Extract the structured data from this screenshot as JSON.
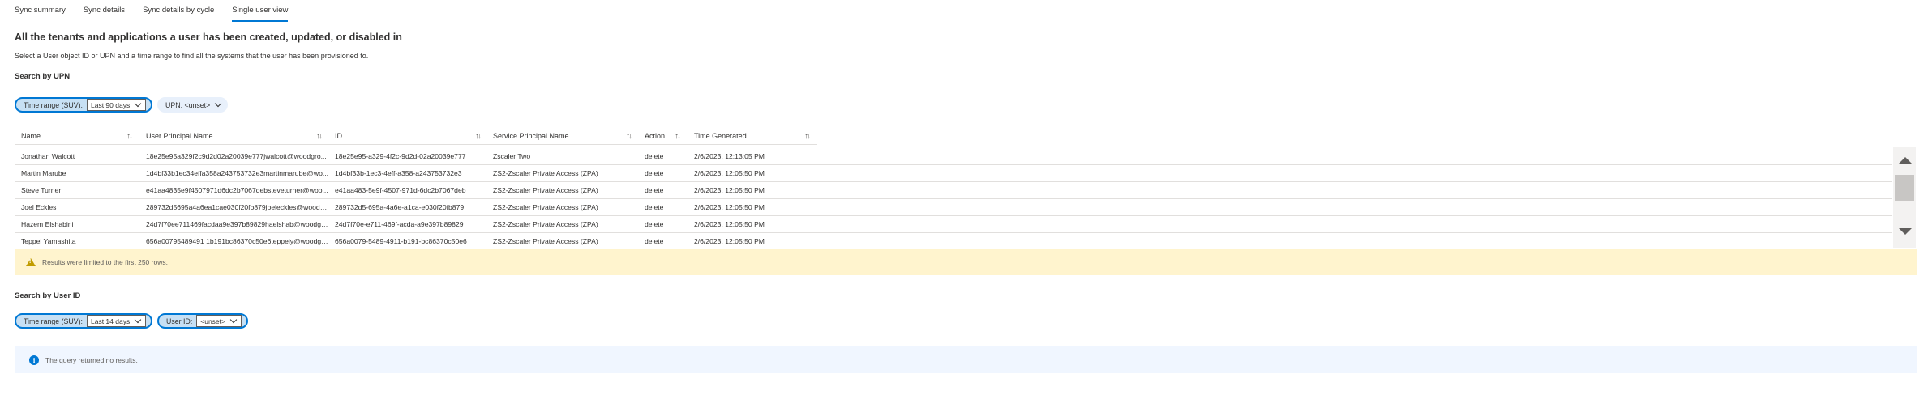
{
  "tabs": [
    {
      "label": "Sync summary"
    },
    {
      "label": "Sync details"
    },
    {
      "label": "Sync details by cycle"
    },
    {
      "label": "Single user view"
    }
  ],
  "active_tab": "Single user view",
  "header": {
    "title": "All the tenants and applications a user has been created, updated, or disabled in",
    "subtitle": "Select a User object ID or UPN and a time range to find all the systems that the user has been provisioned to."
  },
  "upn_section": {
    "label": "Search by UPN",
    "time_range": {
      "label": "Time range (SUV):",
      "value": "Last 90 days"
    },
    "upn_filter": {
      "label": "UPN: <unset>"
    },
    "columns": [
      "Name",
      "User Principal Name",
      "ID",
      "Service Principal Name",
      "Action",
      "Time Generated"
    ],
    "rows": [
      [
        "Jonathan Walcott",
        "18e25e95a329f2c9d2d02a20039e777jwalcott@woodgro...",
        "18e25e95-a329-4f2c-9d2d-02a20039e777",
        "Zscaler Two",
        "delete",
        "2/6/2023, 12:13:05 PM"
      ],
      [
        "Martin Marube",
        "1d4bf33b1ec34effa358a243753732e3martinmarube@wo...",
        "1d4bf33b-1ec3-4eff-a358-a243753732e3",
        "ZS2-Zscaler Private Access (ZPA)",
        "delete",
        "2/6/2023, 12:05:50 PM"
      ],
      [
        "Steve Turner",
        "e41aa4835e9f4507971d6dc2b7067debsteveturner@woo...",
        "e41aa483-5e9f-4507-971d-6dc2b7067deb",
        "ZS2-Zscaler Private Access (ZPA)",
        "delete",
        "2/6/2023, 12:05:50 PM"
      ],
      [
        "Joel Eckles",
        "289732d5695a4a6ea1cae030f20fb879joeleckles@woodgr...",
        "289732d5-695a-4a6e-a1ca-e030f20fb879",
        "ZS2-Zscaler Private Access (ZPA)",
        "delete",
        "2/6/2023, 12:05:50 PM"
      ],
      [
        "Hazem Elshabini",
        "24d7f70ee711469facdaa9e397b89829haelshab@woodgr...",
        "24d7f70e-e711-469f-acda-a9e397b89829",
        "ZS2-Zscaler Private Access (ZPA)",
        "delete",
        "2/6/2023, 12:05:50 PM"
      ],
      [
        "Teppei Yamashita",
        "656a00795489491 1b191bc86370c50e6teppeiy@woodgr...",
        "656a0079-5489-4911-b191-bc86370c50e6",
        "ZS2-Zscaler Private Access (ZPA)",
        "delete",
        "2/6/2023, 12:05:50 PM"
      ]
    ],
    "warning": "Results were limited to the first 250 rows."
  },
  "userid_section": {
    "label": "Search by User ID",
    "time_range": {
      "label": "Time range (SUV):",
      "value": "Last 14 days"
    },
    "user_id": {
      "label": "User ID:",
      "value": "<unset>"
    },
    "info": "The query returned no results."
  },
  "icons": {
    "sort": "sort-arrows-icon",
    "warning": "warning-icon",
    "info": "info-icon",
    "chevron": "chevron-down-icon"
  },
  "colors": {
    "accent": "#0078d4",
    "warning_bg": "#fff4ce",
    "info_bg": "#f0f6ff"
  }
}
